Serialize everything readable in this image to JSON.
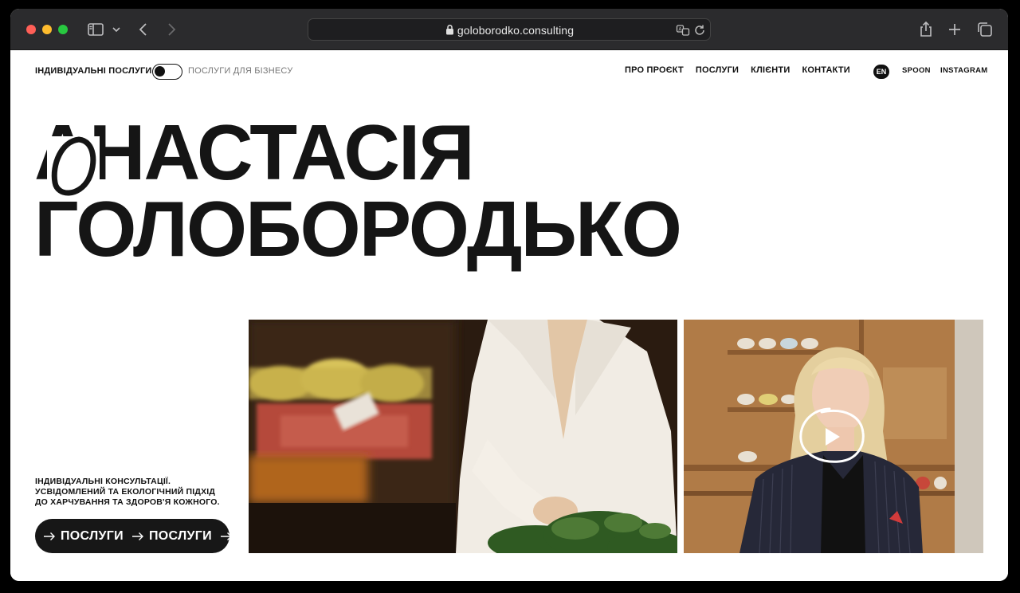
{
  "browser": {
    "url": "goloborodko.consulting"
  },
  "header": {
    "switch_left": "ІНДИВІДУАЛЬНІ ПОСЛУГИ",
    "switch_right": "ПОСЛУГИ ДЛЯ БІЗНЕСУ",
    "nav": [
      {
        "label": "ПРО ПРОЄКТ"
      },
      {
        "label": "ПОСЛУГИ"
      },
      {
        "label": "КЛІЄНТИ"
      },
      {
        "label": "КОНТАКТИ"
      }
    ],
    "lang": "EN",
    "spoon": "SPOON",
    "instagram": "INSTAGRAM"
  },
  "hero": {
    "line1": "АНАСТАСІЯ",
    "line2": "ГОЛОБОРОДЬКО",
    "tagline": [
      "ІНДИВІДУАЛЬНІ КОНСУЛЬТАЦІЇ.",
      "УСВІДОМЛЕНИЙ ТА ЕКОЛОГІЧНИЙ ПІДХІД",
      "ДО ХАРЧУВАННЯ ТА ЗДОРОВ'Я КОЖНОГО."
    ],
    "cta": "ПОСЛУГИ"
  },
  "colors": {
    "toolbar": "#2b2b2d",
    "text": "#111111",
    "button": "#171717"
  }
}
